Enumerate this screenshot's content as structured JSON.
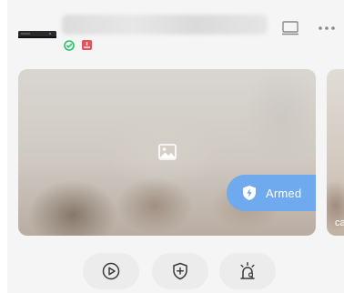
{
  "device": {
    "status_icons": [
      "check-circle-icon",
      "alert-badge-icon"
    ]
  },
  "header_actions": [
    "screen-icon",
    "more-icon"
  ],
  "preview": {
    "placeholder_icon": "image-icon",
    "armed_label": "Armed",
    "next_caption": "ca"
  },
  "actions": [
    {
      "name": "playback",
      "icon": "play-circle-icon"
    },
    {
      "name": "arm",
      "icon": "shield-plus-icon"
    },
    {
      "name": "alarm",
      "icon": "alarm-light-icon"
    }
  ],
  "colors": {
    "accent": "#6fa9ee",
    "status_ok": "#2cc46a",
    "status_alert": "#e4525a",
    "card_bg": "#f5f5f5"
  }
}
